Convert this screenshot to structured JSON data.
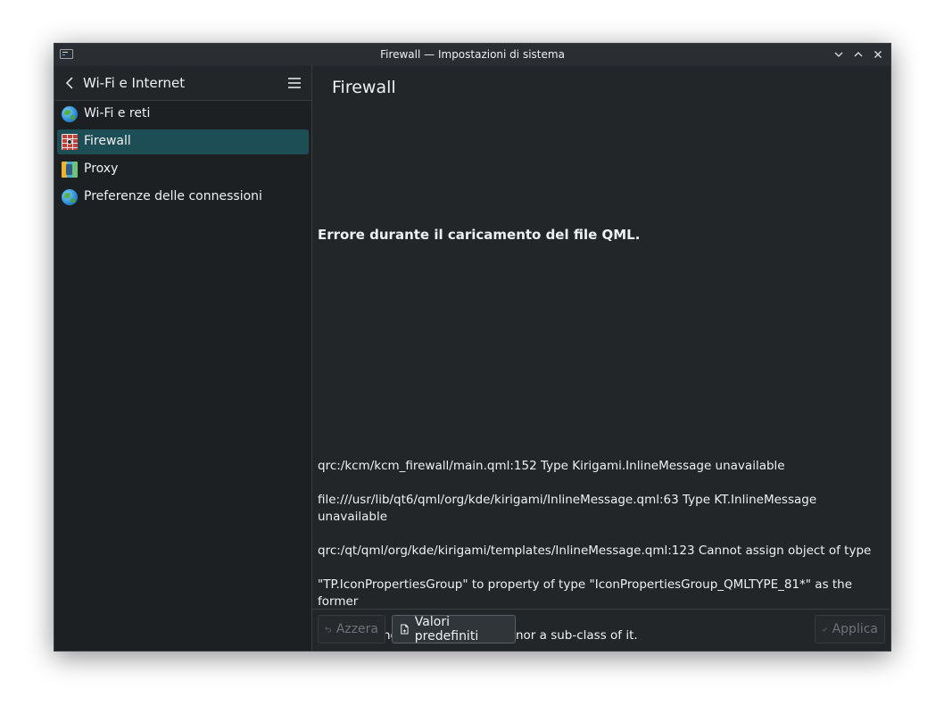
{
  "window": {
    "title": "Firewall — Impostazioni di sistema"
  },
  "sidebar": {
    "header_title": "Wi-Fi e Internet",
    "items": [
      {
        "label": "Wi-Fi e reti",
        "icon": "globe-icon",
        "active": false
      },
      {
        "label": "Firewall",
        "icon": "firewall-icon",
        "active": true
      },
      {
        "label": "Proxy",
        "icon": "proxy-icon",
        "active": false
      },
      {
        "label": "Preferenze delle connessioni",
        "icon": "globe-icon",
        "active": false
      }
    ]
  },
  "main": {
    "title": "Firewall",
    "error_heading": "Errore durante il caricamento del file QML.",
    "error_lines": [
      "qrc:/kcm/kcm_firewall/main.qml:152 Type Kirigami.InlineMessage unavailable",
      "file:///usr/lib/qt6/qml/org/kde/kirigami/InlineMessage.qml:63 Type KT.InlineMessage unavailable",
      "qrc:/qt/qml/org/kde/kirigami/templates/InlineMessage.qml:123 Cannot assign object of type",
      "\"TP.IconPropertiesGroup\" to property of type \"IconPropertiesGroup_QMLTYPE_81*\" as the former",
      "is neither the same as the latter nor a sub-class of it."
    ]
  },
  "footer": {
    "reset_label": "Azzera",
    "defaults_label": "Valori predefiniti",
    "apply_label": "Applica"
  },
  "colors": {
    "accent_selected": "#1e4e55",
    "window_bg": "#232629",
    "sidebar_bg": "#1d2023",
    "text": "#eff0f1",
    "disabled_text": "#6f7378"
  }
}
